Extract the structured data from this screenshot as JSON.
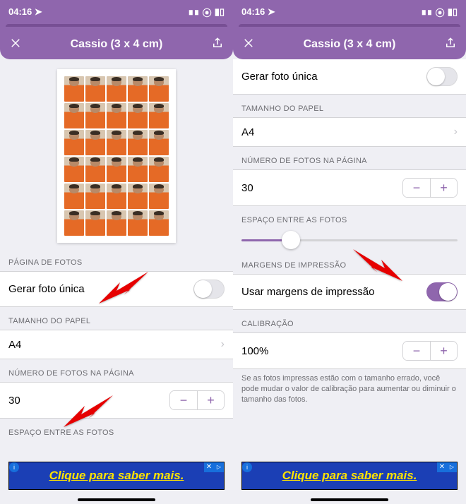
{
  "status": {
    "time": "04:16",
    "location_glyph": "➤",
    "signal": "▪▫",
    "wifi": "●",
    "battery": "■"
  },
  "header": {
    "title": "Cassio (3 x 4 cm)"
  },
  "left": {
    "section_fotos": "PÁGINA DE FOTOS",
    "gerar_label": "Gerar foto única",
    "section_papel": "TAMANHO DO PAPEL",
    "papel_value": "A4",
    "section_num": "NÚMERO DE FOTOS NA PÁGINA",
    "num_value": "30",
    "section_espaco": "ESPAÇO ENTRE AS FOTOS"
  },
  "right": {
    "gerar_label": "Gerar foto única",
    "section_papel": "TAMANHO DO PAPEL",
    "papel_value": "A4",
    "section_num": "NÚMERO DE FOTOS NA PÁGINA",
    "num_value": "30",
    "section_espaco": "ESPAÇO ENTRE AS FOTOS",
    "slider_percent": 23,
    "section_margens": "MARGENS DE IMPRESSÃO",
    "margens_label": "Usar margens de impressão",
    "section_calib": "CALIBRAÇÃO",
    "calib_value": "100%",
    "calib_help": "Se as fotos impressas estão com o tamanho errado, você pode mudar o valor de calibração para aumentar ou diminuir o tamanho das fotos."
  },
  "ad": {
    "text": "Clique para saber mais."
  },
  "colors": {
    "accent": "#8f66ad",
    "ad_bg": "#1b3fb5",
    "ad_text": "#ffe300"
  }
}
